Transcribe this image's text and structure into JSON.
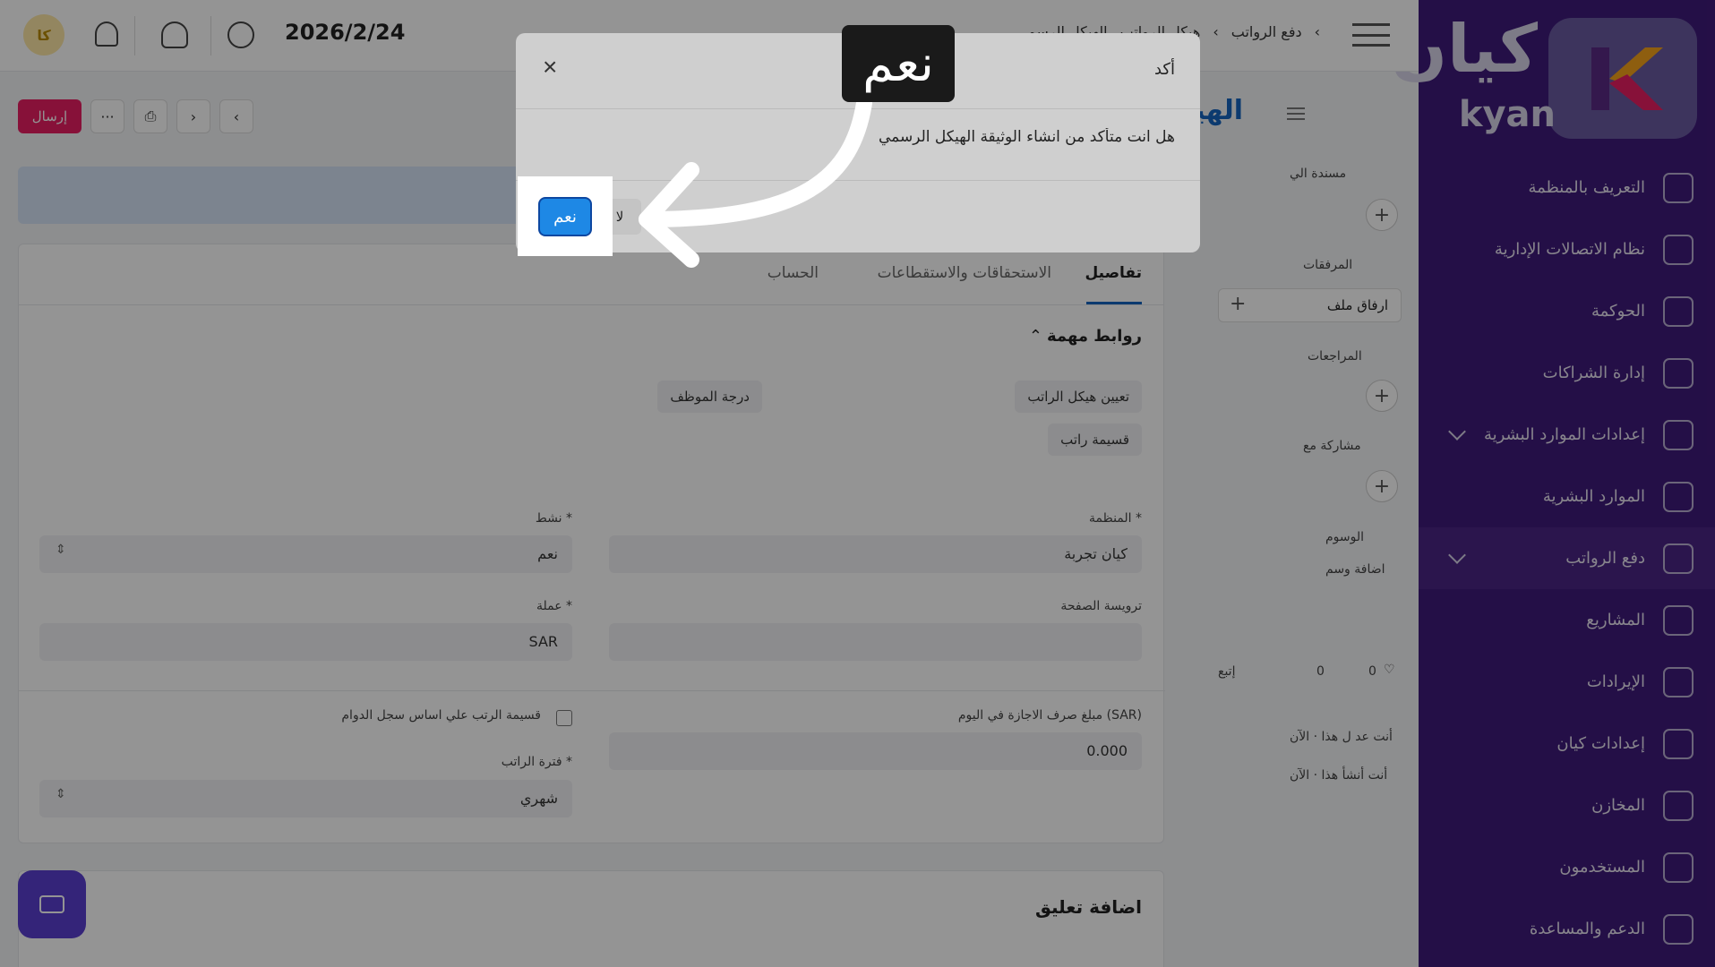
{
  "sidebar": {
    "logo_ar": "كيان",
    "logo_en": "kyan",
    "items": [
      {
        "label": "التعريف بالمنظمة",
        "icon": "store-icon"
      },
      {
        "label": "نظام الاتصالات الإدارية",
        "icon": "swap-icon"
      },
      {
        "label": "الحوكمة",
        "icon": "building-icon"
      },
      {
        "label": "إدارة الشراكات",
        "icon": "contract-icon"
      },
      {
        "label": "إعدادات الموارد البشرية",
        "icon": "briefcase-icon"
      },
      {
        "label": "الموارد البشرية",
        "icon": "users-icon"
      },
      {
        "label": "دفع الرواتب",
        "icon": "coins-icon"
      },
      {
        "label": "المشاريع",
        "icon": "folder-icon"
      },
      {
        "label": "الإيرادات",
        "icon": "card-icon"
      },
      {
        "label": "إعدادات كيان",
        "icon": "toggle-icon"
      },
      {
        "label": "المخازن",
        "icon": "box-icon"
      },
      {
        "label": "المستخدمون",
        "icon": "user-group-icon"
      },
      {
        "label": "الدعم والمساعدة",
        "icon": "headset-icon"
      }
    ]
  },
  "topbar": {
    "breadcrumb_1": "دفع الرواتب",
    "breadcrumb_2": "هيكل الرواتب",
    "breadcrumb_3": "الهيكل الرسمي",
    "date": "2026/2/24",
    "avatar_initials": "كا"
  },
  "page": {
    "title": "الهيكل الرس",
    "send_label": "إرسال",
    "more_label": "···"
  },
  "right_panel": {
    "assigned_to": "مسندة الي",
    "attachments": "المرفقات",
    "attach_file": "ارفاق ملف",
    "reviews": "المراجعات",
    "shared_with": "مشاركة مع",
    "tags": "الوسوم",
    "add_tag": "اضافة وسم",
    "likes": "0",
    "comments": "0",
    "follow": "إتبع",
    "activity_1": "أنت عد ل هذا · الآن",
    "activity_2": "أنت أنشأ هذا · الآن"
  },
  "tabs": [
    {
      "label": "تفاصيل"
    },
    {
      "label": "الاستحقاقات والاستقطاعات"
    },
    {
      "label": "الحساب"
    }
  ],
  "links_section": {
    "title": "روابط مهمة",
    "chips": [
      "تعيين هيكل الراتب",
      "درجة الموظف",
      "قسيمة راتب"
    ]
  },
  "form": {
    "org_label": "المنظمة *",
    "org_value": "كيان تجربة",
    "active_label": "نشط *",
    "active_value": "نعم",
    "letterhead_label": "ترويسة الصفحة",
    "currency_label": "عملة *",
    "currency_value": "SAR",
    "leave_label": "مبلغ صرف الاجازة في اليوم (SAR)",
    "leave_value": "0.000",
    "timesheet_label": "قسيمة الرتب علي اساس سجل الدوام",
    "period_label": "فترة الراتب *",
    "period_value": "شهري"
  },
  "comments_section": {
    "title": "اضافة تعليق"
  },
  "modal": {
    "title": "أكد",
    "message": "هل انت متأكد من انشاء الوثيقة الهيكل الرسمي",
    "no_label": "لا",
    "yes_label": "نعم",
    "callout_text": "نعم"
  }
}
